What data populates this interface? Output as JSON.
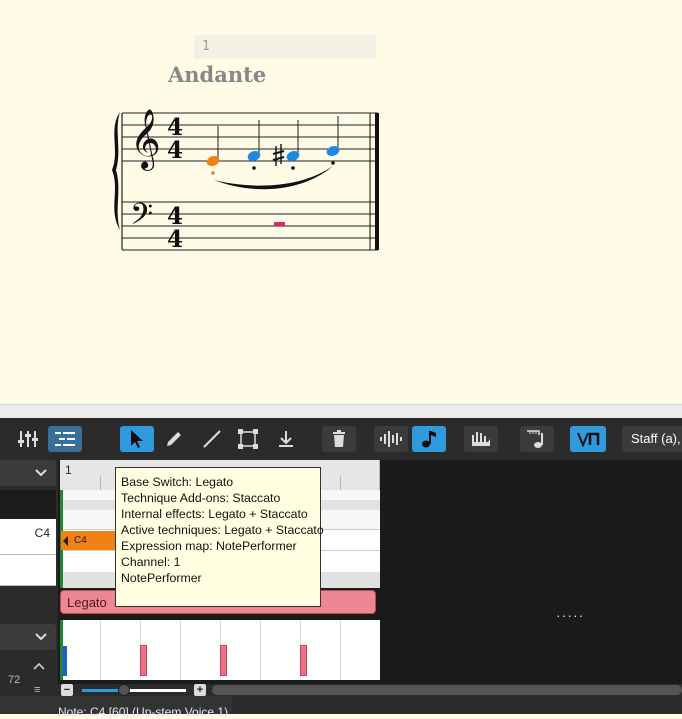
{
  "score": {
    "measure_number": "1",
    "tempo": "Andante"
  },
  "toolbar": {
    "staff_selector": "Staff (a),"
  },
  "piano_roll": {
    "ruler_measure": "1",
    "selected_key_label": "C4",
    "note_label": "C4",
    "articulation_label": "Legato",
    "ellipsis": "·····",
    "spin_value": "72"
  },
  "tooltip": {
    "lines": [
      "Base Switch: Legato",
      "Technique Add-ons: Staccato",
      "Internal effects: Legato + Staccato",
      "Active techniques: Legato + Staccato",
      "Expression map: NotePerformer",
      "Channel: 1",
      "NotePerformer"
    ]
  },
  "zoom": {
    "minus": "−",
    "plus": "+",
    "level": 0.4
  },
  "status": {
    "text": "Note: C4 [60] (Up-stem Voice 1)"
  },
  "colors": {
    "accent": "#2f9bde",
    "selected_note": "#f08213",
    "notes": "#1e88e5",
    "rest": "#e0246a",
    "articulation": "#ee8794",
    "playhead": "#1e8a2e"
  }
}
